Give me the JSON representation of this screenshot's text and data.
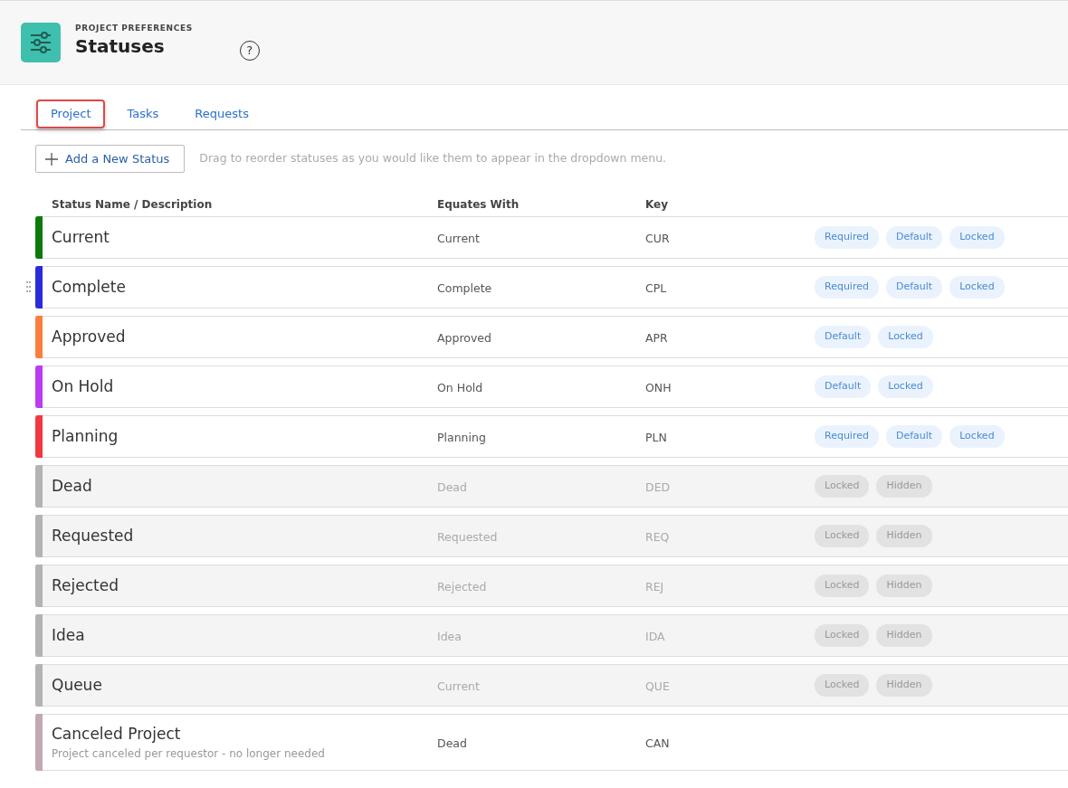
{
  "header": {
    "eyebrow": "PROJECT PREFERENCES",
    "title": "Statuses",
    "help": "?"
  },
  "tabs": [
    {
      "label": "Project",
      "highlighted": true
    },
    {
      "label": "Tasks",
      "highlighted": false
    },
    {
      "label": "Requests",
      "highlighted": false
    }
  ],
  "add_button": {
    "label": "Add a New Status"
  },
  "hint": "Drag to reorder statuses as you would like them to appear in the dropdown menu.",
  "table": {
    "columns": [
      "Status Name / Description",
      "Equates With",
      "Key"
    ],
    "rows": [
      {
        "name": "Current",
        "equates": "Current",
        "key": "CUR",
        "color": "#0b7a0b",
        "hidden": false,
        "hovered": false,
        "tags": [
          "Required",
          "Default",
          "Locked"
        ]
      },
      {
        "name": "Complete",
        "equates": "Complete",
        "key": "CPL",
        "color": "#2b2bd9",
        "hidden": false,
        "hovered": true,
        "tags": [
          "Required",
          "Default",
          "Locked"
        ]
      },
      {
        "name": "Approved",
        "equates": "Approved",
        "key": "APR",
        "color": "#fb7e3c",
        "hidden": false,
        "hovered": false,
        "tags": [
          "Default",
          "Locked"
        ]
      },
      {
        "name": "On Hold",
        "equates": "On Hold",
        "key": "ONH",
        "color": "#bb3bf2",
        "hidden": false,
        "hovered": false,
        "tags": [
          "Default",
          "Locked"
        ]
      },
      {
        "name": "Planning",
        "equates": "Planning",
        "key": "PLN",
        "color": "#f2373f",
        "hidden": false,
        "hovered": false,
        "tags": [
          "Required",
          "Default",
          "Locked"
        ]
      },
      {
        "name": "Dead",
        "equates": "Dead",
        "key": "DED",
        "color": "#b3b3b3",
        "hidden": true,
        "hovered": false,
        "tags": [
          "Locked",
          "Hidden"
        ]
      },
      {
        "name": "Requested",
        "equates": "Requested",
        "key": "REQ",
        "color": "#b3b3b3",
        "hidden": true,
        "hovered": false,
        "tags": [
          "Locked",
          "Hidden"
        ]
      },
      {
        "name": "Rejected",
        "equates": "Rejected",
        "key": "REJ",
        "color": "#b3b3b3",
        "hidden": true,
        "hovered": false,
        "tags": [
          "Locked",
          "Hidden"
        ]
      },
      {
        "name": "Idea",
        "equates": "Idea",
        "key": "IDA",
        "color": "#b3b3b3",
        "hidden": true,
        "hovered": false,
        "tags": [
          "Locked",
          "Hidden"
        ]
      },
      {
        "name": "Queue",
        "equates": "Current",
        "key": "QUE",
        "color": "#b3b3b3",
        "hidden": true,
        "hovered": false,
        "tags": [
          "Locked",
          "Hidden"
        ]
      },
      {
        "name": "Canceled Project",
        "description": "Project canceled per requestor - no longer needed",
        "equates": "Dead",
        "key": "CAN",
        "color": "#c4a7b4",
        "hidden": false,
        "hovered": false,
        "tags": []
      }
    ]
  }
}
